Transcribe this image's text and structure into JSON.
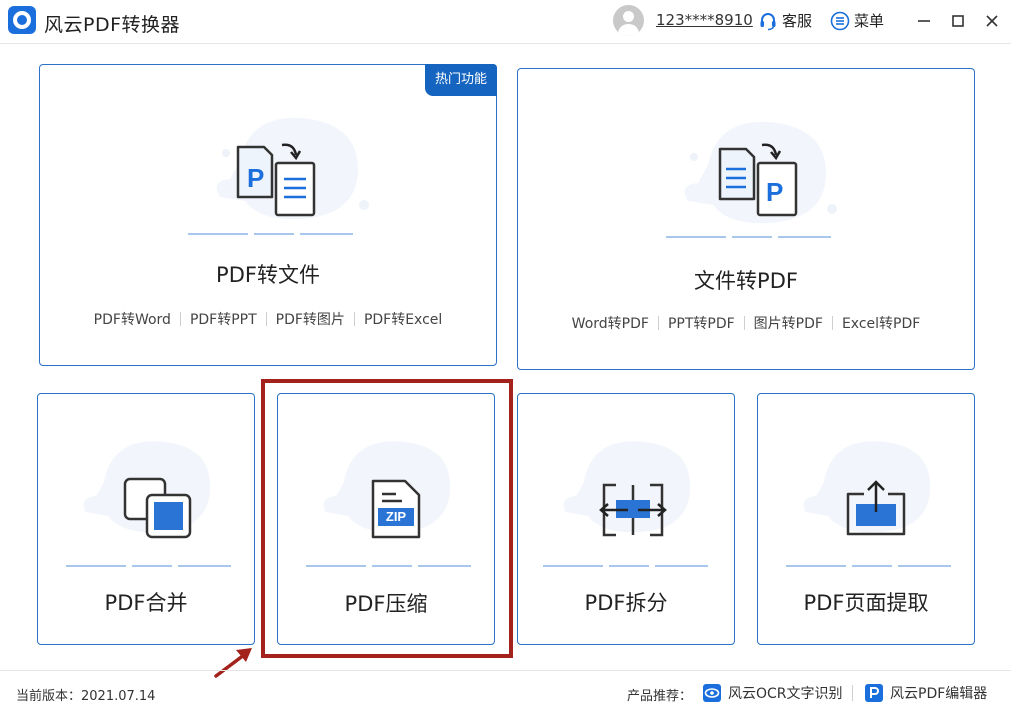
{
  "app": {
    "title": "风云PDF转换器"
  },
  "header": {
    "account": "123****8910",
    "service_label": "客服",
    "menu_label": "菜单"
  },
  "cards": {
    "pdf_to_file": {
      "badge": "热门功能",
      "title": "PDF转文件",
      "links": [
        "PDF转Word",
        "PDF转PPT",
        "PDF转图片",
        "PDF转Excel"
      ]
    },
    "file_to_pdf": {
      "title": "文件转PDF",
      "links": [
        "Word转PDF",
        "PPT转PDF",
        "图片转PDF",
        "Excel转PDF"
      ]
    },
    "merge": {
      "title": "PDF合并"
    },
    "compress": {
      "title": "PDF压缩",
      "icon_text": "ZIP"
    },
    "split": {
      "title": "PDF拆分"
    },
    "extract": {
      "title": "PDF页面提取"
    }
  },
  "footer": {
    "version": "当前版本：2021.07.14",
    "recommend_label": "产品推荐：",
    "products": [
      "风云OCR文字识别",
      "风云PDF编辑器"
    ]
  },
  "colors": {
    "accent": "#1a6fdc",
    "card_border": "#2c72c7",
    "badge_bg": "#1565c0",
    "highlight": "#a3221c"
  }
}
